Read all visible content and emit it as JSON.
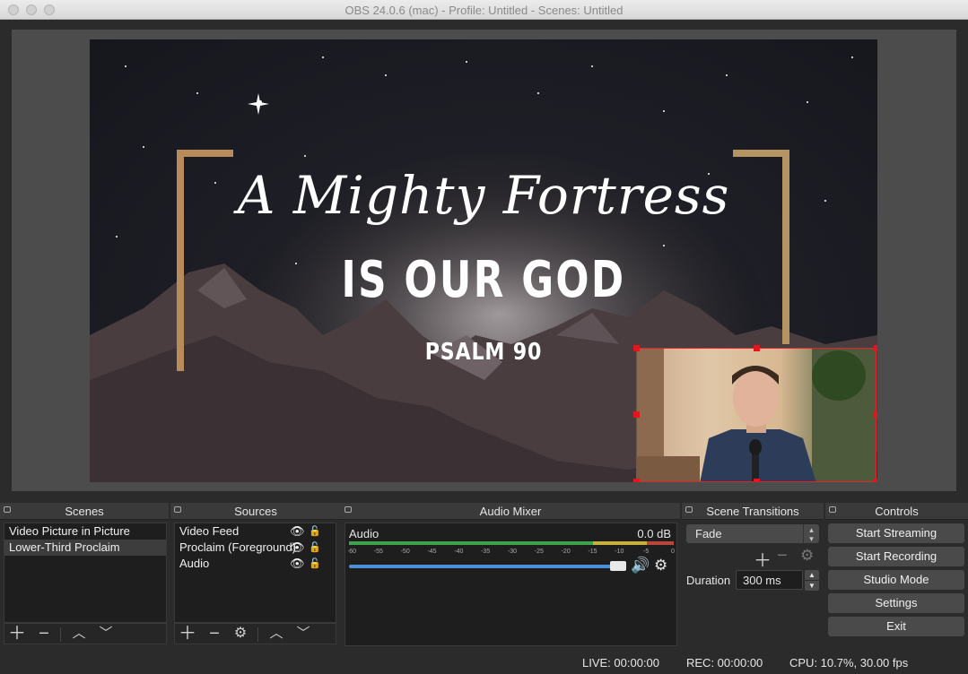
{
  "window": {
    "title": "OBS 24.0.6 (mac) - Profile: Untitled - Scenes: Untitled"
  },
  "preview": {
    "script_title": "A Mighty Fortress",
    "subtitle": "IS OUR GOD",
    "reference": "PSALM 90"
  },
  "scenes": {
    "header": "Scenes",
    "items": [
      {
        "label": "Video Picture in Picture",
        "selected": false
      },
      {
        "label": "Lower-Third Proclaim",
        "selected": true
      }
    ]
  },
  "sources": {
    "header": "Sources",
    "items": [
      {
        "label": "Video Feed"
      },
      {
        "label": "Proclaim (Foreground)"
      },
      {
        "label": "Audio"
      }
    ]
  },
  "mixer": {
    "header": "Audio Mixer",
    "channel": "Audio",
    "level": "0.0 dB",
    "ticks": [
      "-60",
      "-55",
      "-50",
      "-45",
      "-40",
      "-35",
      "-30",
      "-25",
      "-20",
      "-15",
      "-10",
      "-5",
      "0"
    ],
    "volume": 1.0
  },
  "transitions": {
    "header": "Scene Transitions",
    "selected": "Fade",
    "duration_label": "Duration",
    "duration_value": "300 ms"
  },
  "controls": {
    "header": "Controls",
    "start_streaming": "Start Streaming",
    "start_recording": "Start Recording",
    "studio_mode": "Studio Mode",
    "settings": "Settings",
    "exit": "Exit"
  },
  "status": {
    "live": "LIVE: 00:00:00",
    "rec": "REC: 00:00:00",
    "cpu": "CPU: 10.7%, 30.00 fps"
  },
  "colors": {
    "meter_green": "#3ea34a",
    "meter_yellow": "#c7b13c",
    "meter_red": "#b8473a",
    "slider_blue": "#4a90d9",
    "selection_red": "#e3161d"
  }
}
